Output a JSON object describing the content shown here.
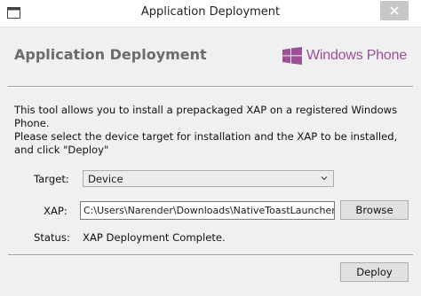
{
  "window": {
    "title": "Application Deployment"
  },
  "header": {
    "heading": "Application Deployment",
    "brand": "Windows Phone",
    "brand_color": "#9b4f96"
  },
  "description": {
    "line1": "This tool allows you to install a prepackaged XAP on a registered Windows Phone.",
    "line2": "Please select the device target for installation and the XAP to be installed, and click \"Deploy\""
  },
  "form": {
    "target_label": "Target:",
    "target_value": "Device",
    "xap_label": "XAP:",
    "xap_value": "C:\\Users\\Narender\\Downloads\\NativeToastLauncherApp",
    "browse_label": "Browse",
    "status_label": "Status:",
    "status_value": "XAP Deployment Complete."
  },
  "footer": {
    "deploy_label": "Deploy"
  },
  "icons": {
    "app": "app-window-icon",
    "close": "close-icon",
    "brand": "windows-logo-icon",
    "dropdown": "chevron-down-icon"
  }
}
